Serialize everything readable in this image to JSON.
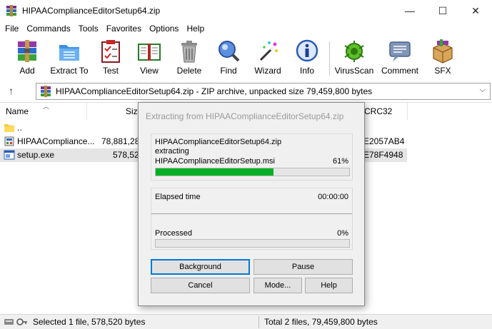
{
  "window": {
    "title": "HIPAAComplianceEditorSetup64.zip",
    "minimize_glyph": "—",
    "maximize_glyph": "☐",
    "close_glyph": "✕"
  },
  "menu": [
    "File",
    "Commands",
    "Tools",
    "Favorites",
    "Options",
    "Help"
  ],
  "toolbar": {
    "add": "Add",
    "extract_to": "Extract To",
    "test": "Test",
    "view": "View",
    "delete": "Delete",
    "find": "Find",
    "wizard": "Wizard",
    "info": "Info",
    "virusscan": "VirusScan",
    "comment": "Comment",
    "sfx": "SFX"
  },
  "address": {
    "up_glyph": "↑",
    "text": "HIPAAComplianceEditorSetup64.zip - ZIP archive, unpacked size 79,459,800 bytes",
    "chevron": "⌵"
  },
  "columns": {
    "name": "Name",
    "size": "Size",
    "crc": "CRC32"
  },
  "files": [
    {
      "name": "..",
      "size": "",
      "crc": ""
    },
    {
      "name": "HIPAACompliance...",
      "size": "78,881,280",
      "crc": "E2057AB4"
    },
    {
      "name": "setup.exe",
      "size": "578,520",
      "crc": "E78F4948"
    }
  ],
  "status": {
    "left": "Selected 1 file, 578,520 bytes",
    "right": "Total 2 files, 79,459,800 bytes"
  },
  "dialog": {
    "title": "Extracting from HIPAAComplianceEditorSetup64.zip",
    "archive": "HIPAAComplianceEditorSetup64.zip",
    "action": "extracting",
    "current_file": "HIPAAComplianceEditorSetup.msi",
    "file_percent": "61%",
    "file_progress": 0.61,
    "elapsed_label": "Elapsed time",
    "elapsed_value": "00:00:00",
    "processed_label": "Processed",
    "processed_percent": "0%",
    "processed_progress": 0,
    "buttons": {
      "background": "Background",
      "pause": "Pause",
      "cancel": "Cancel",
      "mode": "Mode...",
      "help": "Help"
    }
  },
  "colors": {
    "progress_green": "#06b025",
    "default_button_border": "#0078d7",
    "selection": "#e5e5e5"
  }
}
